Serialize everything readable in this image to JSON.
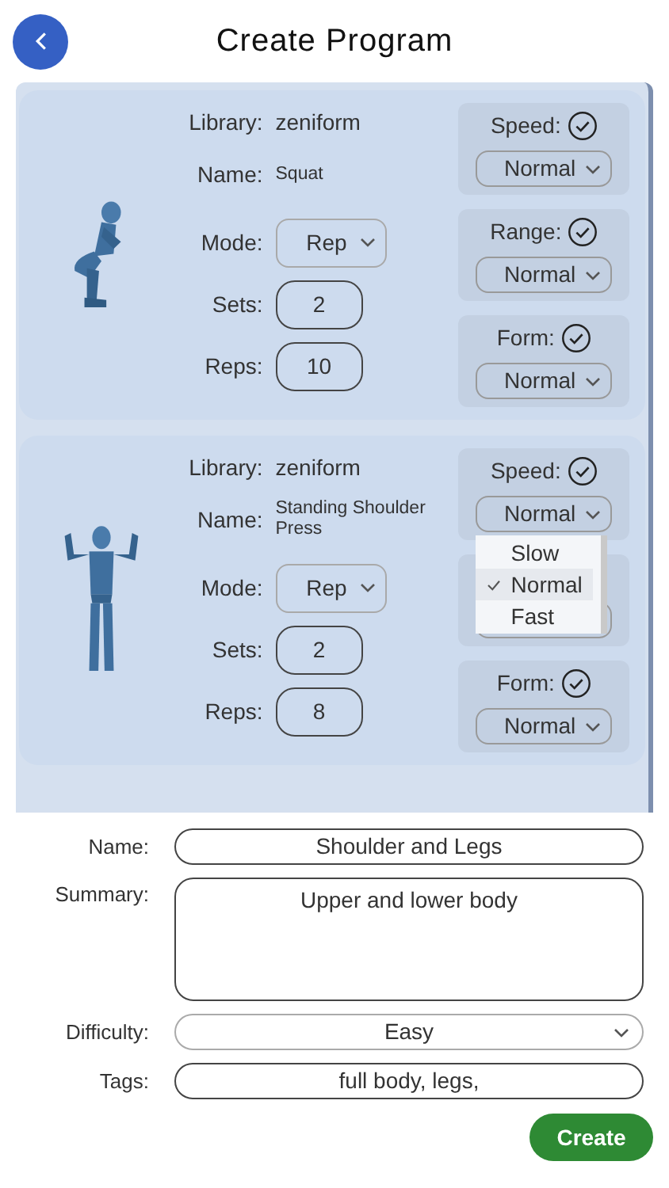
{
  "header": {
    "title": "Create Program"
  },
  "exercises": [
    {
      "library_label": "Library:",
      "library": "zeniform",
      "name_label": "Name:",
      "name": "Squat",
      "mode_label": "Mode:",
      "mode": "Rep",
      "sets_label": "Sets:",
      "sets": "2",
      "reps_label": "Reps:",
      "reps": "10",
      "settings": [
        {
          "kind": "setting",
          "label": "Speed:",
          "checked": true,
          "value": "Normal"
        },
        {
          "kind": "setting",
          "label": "Range:",
          "checked": true,
          "value": "Normal"
        },
        {
          "kind": "setting",
          "label": "Form:",
          "checked": true,
          "value": "Normal"
        }
      ]
    },
    {
      "library_label": "Library:",
      "library": "zeniform",
      "name_label": "Name:",
      "name": "Standing Shoulder Press",
      "mode_label": "Mode:",
      "mode": "Rep",
      "sets_label": "Sets:",
      "sets": "2",
      "reps_label": "Reps:",
      "reps": "8",
      "settings": [
        {
          "kind": "setting",
          "label": "Speed:",
          "checked": true,
          "value": "Normal",
          "menu": {
            "options": [
              {
                "label": "Slow",
                "selected": false
              },
              {
                "label": "Normal",
                "selected": true
              },
              {
                "label": "Fast",
                "selected": false
              }
            ]
          }
        },
        {
          "kind": "covered"
        },
        {
          "kind": "setting",
          "label": "Form:",
          "checked": true,
          "value": "Normal"
        }
      ]
    }
  ],
  "form": {
    "fields": [
      {
        "kind": "input",
        "label": "Name:",
        "value": "Shoulder and Legs"
      },
      {
        "kind": "textarea",
        "label": "Summary:",
        "value": "Upper and lower body"
      },
      {
        "kind": "select",
        "label": "Difficulty:",
        "value": "Easy"
      },
      {
        "kind": "input",
        "label": "Tags:",
        "value": "full body, legs,"
      }
    ]
  },
  "create_button": {
    "label": "Create"
  }
}
